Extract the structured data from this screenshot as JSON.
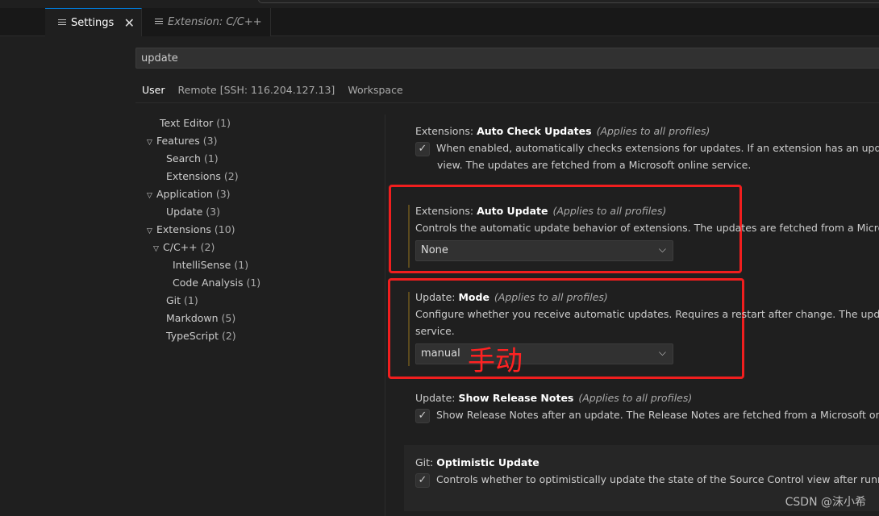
{
  "tabs": [
    {
      "label": "Settings",
      "icon": "settings-lines-icon",
      "active": true
    },
    {
      "label": "Extension: C/C++",
      "icon": "extension-lines-icon",
      "active": false
    }
  ],
  "search": {
    "value": "update"
  },
  "scopes": [
    "User",
    "Remote [SSH: 116.204.127.13]",
    "Workspace"
  ],
  "toc": [
    {
      "label": "Text Editor",
      "count": "(1)"
    },
    {
      "label": "Features",
      "count": "(3)"
    },
    {
      "label": "Search",
      "count": "(1)"
    },
    {
      "label": "Extensions",
      "count": "(2)"
    },
    {
      "label": "Application",
      "count": "(3)"
    },
    {
      "label": "Update",
      "count": "(3)"
    },
    {
      "label": "Extensions",
      "count": "(10)"
    },
    {
      "label": "C/C++",
      "count": "(2)"
    },
    {
      "label": "IntelliSense",
      "count": "(1)"
    },
    {
      "label": "Code Analysis",
      "count": "(1)"
    },
    {
      "label": "Git",
      "count": "(1)"
    },
    {
      "label": "Markdown",
      "count": "(5)"
    },
    {
      "label": "TypeScript",
      "count": "(2)"
    }
  ],
  "settings": [
    {
      "category": "Extensions: ",
      "name": "Auto Check Updates",
      "scope": "(Applies to all profiles)",
      "checked": true,
      "desc1": "When enabled, automatically checks extensions for updates. If an extension has an update, it is r",
      "desc2": "view. The updates are fetched from a Microsoft online service."
    },
    {
      "category": "Extensions: ",
      "name": "Auto Update",
      "scope": "(Applies to all profiles)",
      "desc1": "Controls the automatic update behavior of extensions. The updates are fetched from a Microsoft onl",
      "value": "None"
    },
    {
      "category": "Update: ",
      "name": "Mode",
      "scope": "(Applies to all profiles)",
      "desc1": "Configure whether you receive automatic updates. Requires a restart after change. The updates are fe",
      "desc2": "service.",
      "value": "manual"
    },
    {
      "category": "Update: ",
      "name": "Show Release Notes",
      "scope": "(Applies to all profiles)",
      "checked": true,
      "desc1": "Show Release Notes after an update. The Release Notes are fetched from a Microsoft online serv"
    },
    {
      "category": "Git: ",
      "name": "Optimistic Update",
      "checked": true,
      "desc1": "Controls whether to optimistically update the state of the Source Control view after running git c"
    }
  ],
  "annotation": "手动",
  "watermark": "CSDN @沫小希",
  "colors": {
    "annotation": "#f01e1e",
    "accent": "#0078d4"
  }
}
